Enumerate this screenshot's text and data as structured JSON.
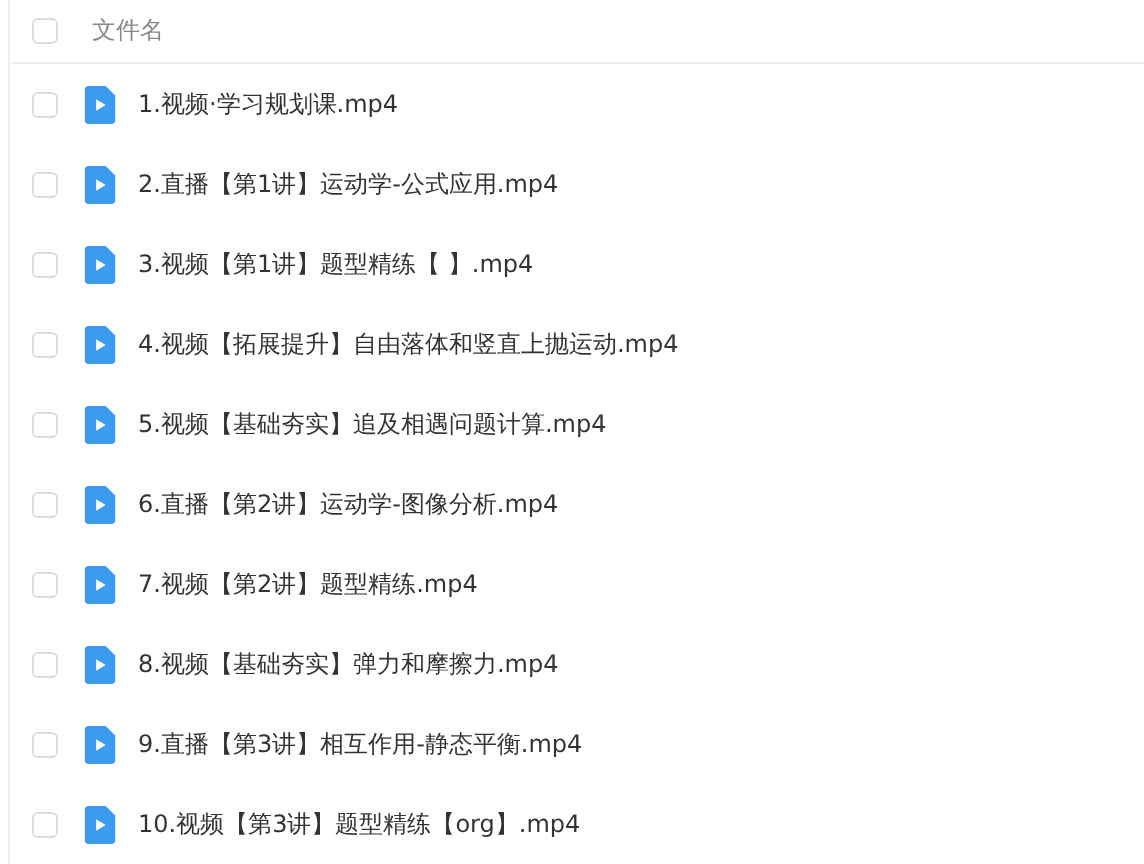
{
  "header": {
    "checked": false,
    "label": "文件名"
  },
  "files": [
    {
      "name": "1.视频·学习规划课.mp4",
      "checked": false
    },
    {
      "name": "2.直播【第1讲】运动学-公式应用.mp4",
      "checked": false
    },
    {
      "name": "3.视频【第1讲】题型精练【 】.mp4",
      "checked": false
    },
    {
      "name": "4.视频【拓展提升】自由落体和竖直上抛运动.mp4",
      "checked": false
    },
    {
      "name": "5.视频【基础夯实】追及相遇问题计算.mp4",
      "checked": false
    },
    {
      "name": "6.直播【第2讲】运动学-图像分析.mp4",
      "checked": false
    },
    {
      "name": "7.视频【第2讲】题型精练.mp4",
      "checked": false
    },
    {
      "name": "8.视频【基础夯实】弹力和摩擦力.mp4",
      "checked": false
    },
    {
      "name": "9.直播【第3讲】相互作用-静态平衡.mp4",
      "checked": false
    },
    {
      "name": "10.视频【第3讲】题型精练【org】.mp4",
      "checked": false
    }
  ]
}
